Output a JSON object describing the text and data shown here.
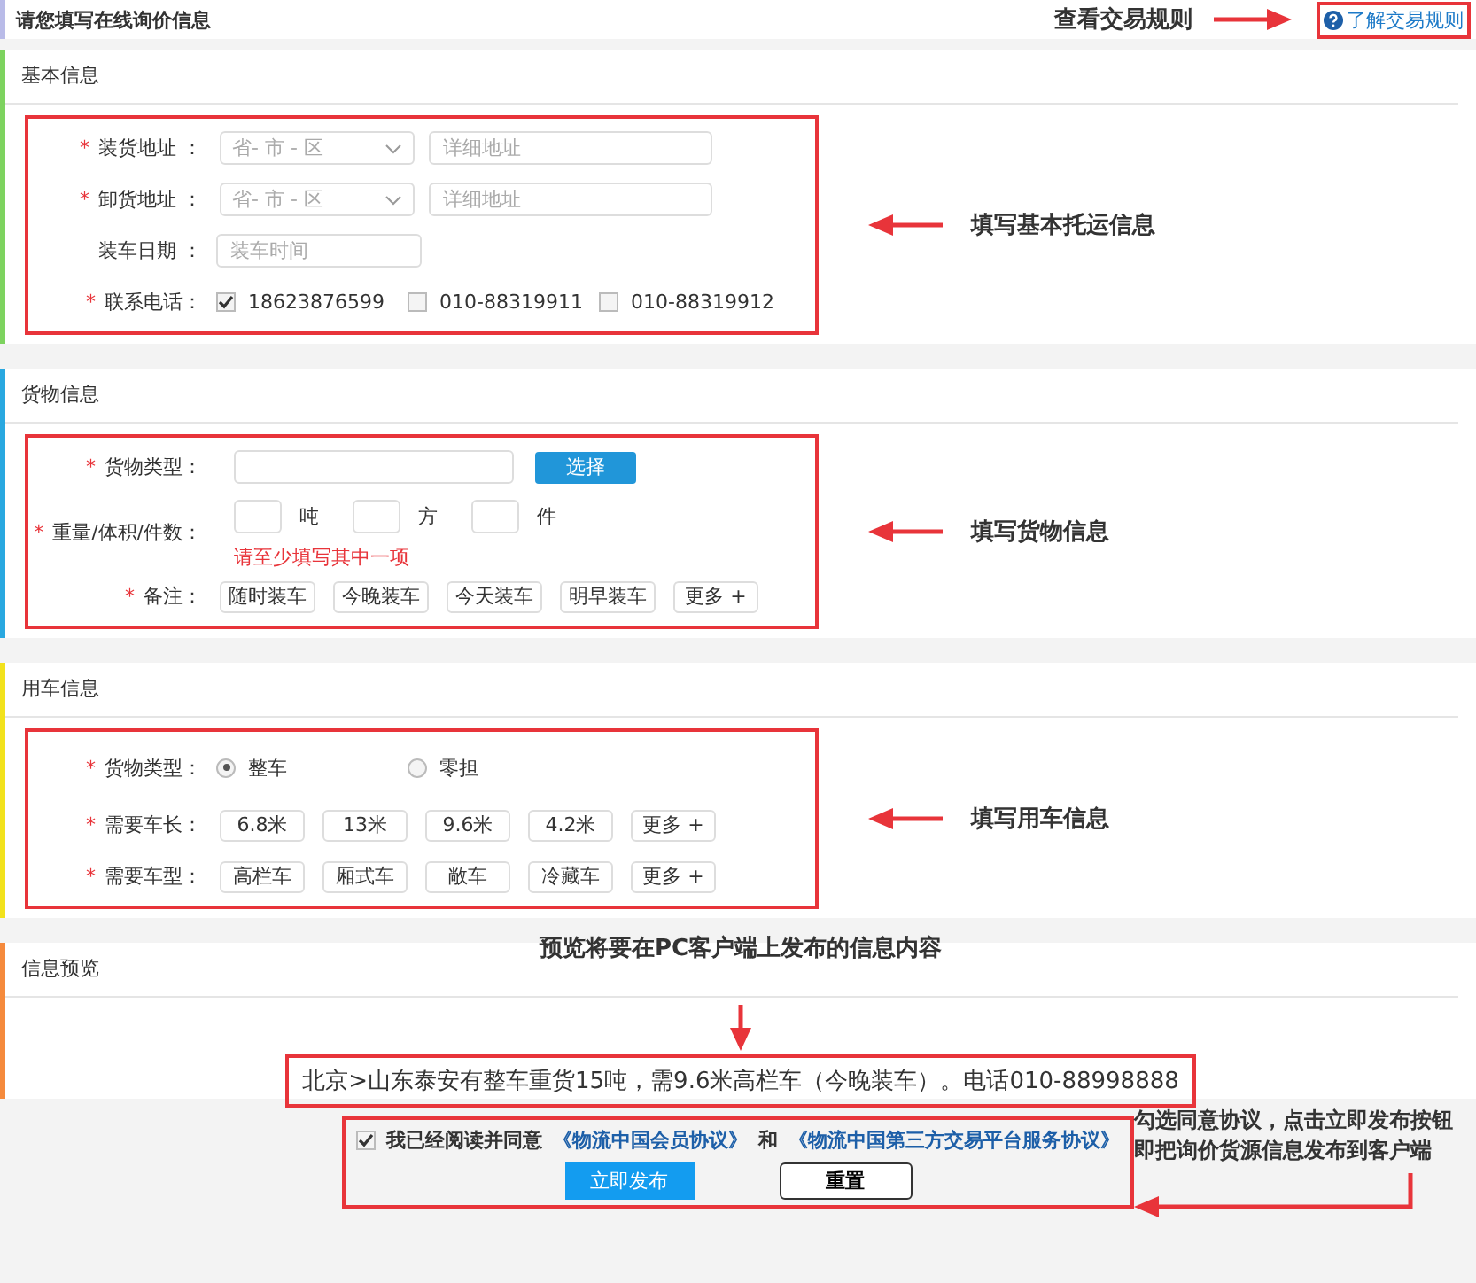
{
  "required_mark": "*",
  "header": {
    "title": "请您填写在线询价信息",
    "note": "查看交易规则",
    "link": "了解交易规则"
  },
  "sections": [
    {
      "title": "基本信息",
      "color": "#7dd35f",
      "note": "填写基本托运信息",
      "rows": [
        {
          "kind": "address",
          "label": "装货地址 ：",
          "required": true,
          "region_placeholder": "省- 市 - 区",
          "detail_placeholder": "详细地址"
        },
        {
          "kind": "address",
          "label": "卸货地址 ：",
          "required": true,
          "region_placeholder": "省- 市 - 区",
          "detail_placeholder": "详细地址"
        },
        {
          "kind": "date",
          "label": "装车日期 ：",
          "required": false,
          "placeholder": "装车时间"
        },
        {
          "kind": "checks",
          "label": "联系电话：",
          "required": true,
          "options": [
            {
              "label": "18623876599",
              "checked": true
            },
            {
              "label": "010-88319911",
              "checked": false
            },
            {
              "label": "010-88319912",
              "checked": false
            }
          ]
        }
      ]
    },
    {
      "title": "货物信息",
      "color": "#29a8e0",
      "note": "填写货物信息",
      "rows": [
        {
          "kind": "picker",
          "label": "货物类型：",
          "required": true,
          "button": "选择"
        },
        {
          "kind": "quantities",
          "label": "重量/体积/件数：",
          "required": true,
          "units": [
            "吨",
            "方",
            "件"
          ],
          "hint": "请至少填写其中一项"
        },
        {
          "kind": "tags",
          "label": "备注：",
          "required": true,
          "tags": [
            "随时装车",
            "今晚装车",
            "今天装车",
            "明早装车",
            "更多 +"
          ]
        }
      ]
    },
    {
      "title": "用车信息",
      "color": "#f2e21c",
      "note": "填写用车信息",
      "rows": [
        {
          "kind": "radios",
          "label": "货物类型：",
          "required": true,
          "options": [
            {
              "label": "整车",
              "selected": true
            },
            {
              "label": "零担",
              "selected": false
            }
          ]
        },
        {
          "kind": "tags",
          "label": "需要车长：",
          "required": true,
          "tags": [
            "6.8米",
            "13米",
            "9.6米",
            "4.2米",
            "更多 +"
          ]
        },
        {
          "kind": "tags",
          "label": "需要车型：",
          "required": true,
          "tags": [
            "高栏车",
            "厢式车",
            "敞车",
            "冷藏车",
            "更多 +"
          ]
        }
      ]
    }
  ],
  "preview": {
    "title": "信息预览",
    "color": "#f58a3c",
    "note": "预览将要在PC客户端上发布的信息内容",
    "text": "北京>山东泰安有整车重货15吨，需9.6米高栏车（今晚装车）。电话010-88998888"
  },
  "footer": {
    "agree_checked": true,
    "agree_text": "我已经阅读并同意",
    "link_1": "《物流中国会员协议》",
    "joiner": "和",
    "link_2": "《物流中国第三方交易平台服务协议》",
    "buttons": [
      "立即发布",
      "重置"
    ],
    "note": [
      "勾选同意协议，点击立即发布按钮",
      "即把询价货源信息发布到客户端"
    ]
  }
}
